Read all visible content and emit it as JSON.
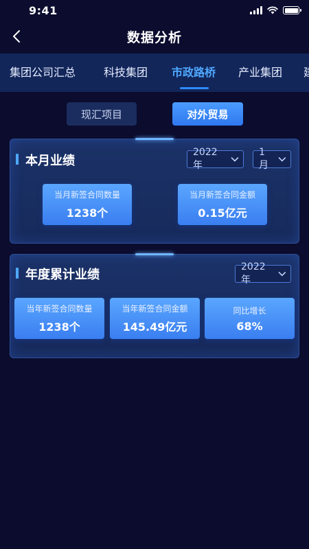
{
  "status_bar": {
    "time": "9:41"
  },
  "nav": {
    "title": "数据分析"
  },
  "tabs": [
    {
      "label": "集团公司汇总",
      "active": false
    },
    {
      "label": "科技集团",
      "active": false
    },
    {
      "label": "市政路桥",
      "active": true
    },
    {
      "label": "产业集团",
      "active": false
    },
    {
      "label": "建",
      "active": false
    }
  ],
  "segments": [
    {
      "label": "现汇项目",
      "active": false
    },
    {
      "label": "对外贸易",
      "active": true
    }
  ],
  "monthly": {
    "title": "本月业绩",
    "year_select": "2022年",
    "month_select": "1月",
    "stats": [
      {
        "label": "当月新签合同数量",
        "value": "1238个"
      },
      {
        "label": "当月新签合同金额",
        "value": "0.15亿元"
      }
    ]
  },
  "annual": {
    "title": "年度累计业绩",
    "year_select": "2022年",
    "stats": [
      {
        "label": "当年新签合同数量",
        "value": "1238个"
      },
      {
        "label": "当年新签合同金额",
        "value": "145.49亿元"
      },
      {
        "label": "同比增长",
        "value": "68%"
      }
    ]
  },
  "colors": {
    "background": "#0b0c2e",
    "tab_bar": "#12265a",
    "accent": "#2f8bff",
    "tile": "#4a90f5"
  }
}
